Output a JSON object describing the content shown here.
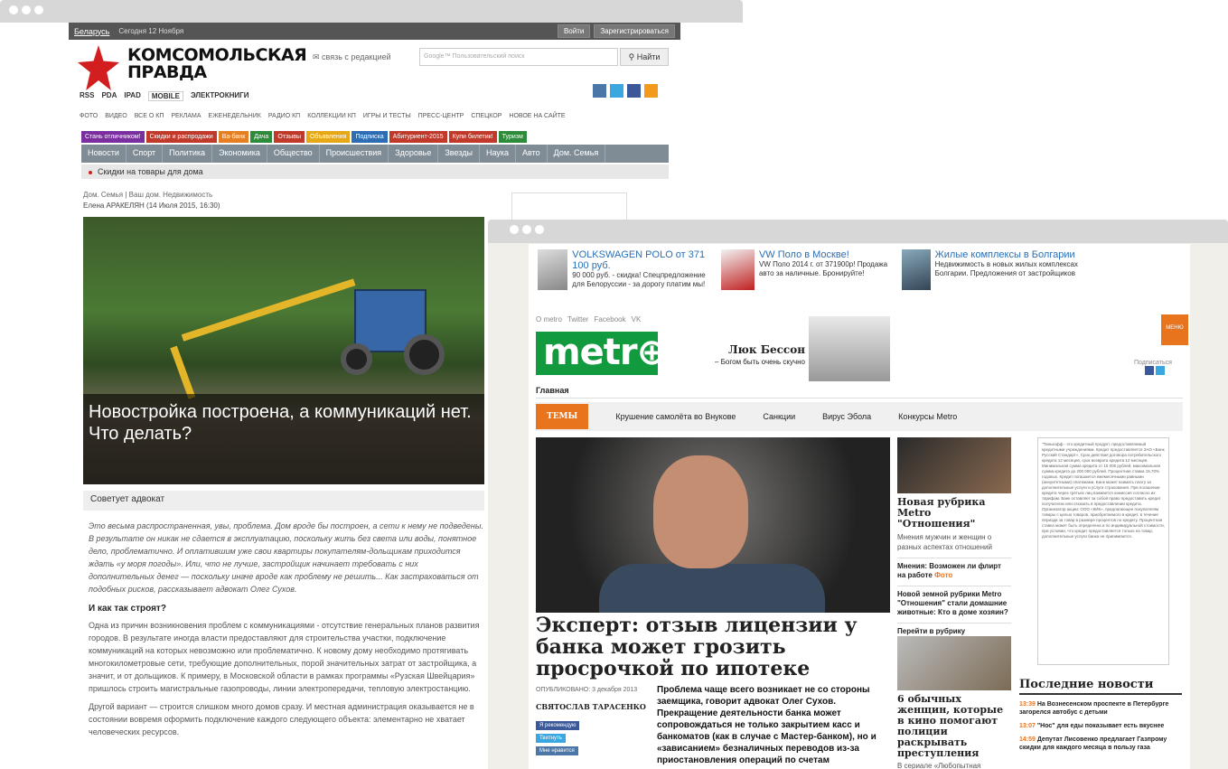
{
  "kp": {
    "region": "Беларусь",
    "today": "Сегодня 12 Ноября",
    "login": "Войти",
    "register": "Зарегистрироваться",
    "logo_line1": "КОМСОМОЛЬСКАЯ",
    "logo_line2": "ПРАВДА",
    "contact": "связь с редакцией",
    "search_placeholder": "Google™ Пользовательский поиск",
    "search_btn": "Найти",
    "links1": [
      "RSS",
      "PDA",
      "IPAD",
      "MOBILE",
      "ЭЛЕКТРОКНИГИ"
    ],
    "links2": [
      "ФОТО",
      "ВИДЕО",
      "ВСЕ О КП",
      "РЕКЛАМА",
      "ЕЖЕНЕДЕЛЬНИК",
      "РАДИО КП",
      "КОЛЛЕКЦИИ КП",
      "ИГРЫ И ТЕСТЫ",
      "ПРЕСС-ЦЕНТР",
      "СПЕЦКОР",
      "НОВОЕ НА САЙТЕ"
    ],
    "pills": [
      {
        "t": "Стань отличником!",
        "c": "#7a2ea0"
      },
      {
        "t": "Скидки и распродажи",
        "c": "#c0392b"
      },
      {
        "t": "Ва-банк",
        "c": "#e67e22"
      },
      {
        "t": "Дача",
        "c": "#2e8b3a"
      },
      {
        "t": "Отзывы",
        "c": "#c0392b"
      },
      {
        "t": "Объявления",
        "c": "#e6a817"
      },
      {
        "t": "Подписка",
        "c": "#2c6db3"
      },
      {
        "t": "Абитуриент-2015",
        "c": "#c0392b"
      },
      {
        "t": "Купи билетик!",
        "c": "#c0392b"
      },
      {
        "t": "Туризм",
        "c": "#2e8b3a"
      }
    ],
    "nav": [
      "Новости",
      "Спорт",
      "Политика",
      "Экономика",
      "Общество",
      "Происшествия",
      "Здоровье",
      "Звезды",
      "Наука",
      "Авто",
      "Дом. Семья"
    ],
    "promo": "Скидки на товары для дома",
    "rubric": "Дом. Семья | Ваш дом. Недвижимость",
    "author": "Елена АРАКЕЛЯН  (14 Июля 2015, 16:30)",
    "photo_caption": "Новостройка построена, а коммуникаций нет. Что делать?",
    "advice": "Советует адвокат",
    "intro": "Это весьма распространенная, увы, проблема. Дом вроде бы построен, а сети к нему не подведены. В результате он никак не сдается в эксплуатацию, поскольку жить без света или воды, понятное дело, проблематично. И оплатившим уже свои квартиры покупателям-дольщикам приходится ждать «у моря погоды». Или, что не лучше, застройщик начинает требовать с них дополнительных денег — поскольку иначе вроде как проблему не решить... Как застраховаться от подобных рисков, рассказывает адвокат Олег Сухов.",
    "subhead": "И как так строят?",
    "p1": "Одна из причин возникновения проблем с коммуникациями - отсутствие генеральных планов развития городов. В результате иногда власти предоставляют для строительства участки, подключение коммуникаций на которых невозможно или проблематично. К новому дому необходимо протягивать многокилометровые сети, требующие дополнительных, порой значительных затрат от застройщика, а значит, и от дольщиков. К примеру, в Московской области в рамках программы «Рузская Швейцария» пришлось строить магистральные газопроводы, линии электропередачи, тепловую электростанцию.",
    "p2": "Другой вариант — строится слишком много домов сразу. И местная администрация оказывается не в состоянии вовремя оформить подключение каждого следующего объекта: элементарно не хватает человеческих ресурсов."
  },
  "metro": {
    "ads": [
      {
        "title": "VOLKSWAGEN POLO от 371 100 руб.",
        "desc": "90 000 руб. - скидка! Спецпредложение для Белоруссии - за дорогу платим мы!"
      },
      {
        "title": "VW Поло в Москве!",
        "desc": "VW Поло 2014 г. от 371900р! Продажа авто за наличные. Бронируйте!"
      },
      {
        "title": "Жилые комплексы в Болгарии",
        "desc": "Недвижимость в новых жилых комплексах Болгарии. Предложения от застройщиков"
      }
    ],
    "toplinks": [
      "О metro",
      "Twitter",
      "Facebook",
      "VK"
    ],
    "logo": "metr",
    "besson_name": "Люк Бессон",
    "besson_quote": "– Богом быть очень скучно",
    "menu": "МЕНЮ",
    "subscribe": "Подписаться",
    "home": "Главная",
    "topics_label": "ТЕМЫ",
    "topics": [
      "Крушение самолёта во Внукове",
      "Санкции",
      "Вирус Эбола",
      "Конкурсы Metro"
    ],
    "headline": "Эксперт: отзыв лицензии у банка может грозить просрочкой по ипотеке",
    "published": "ОПУБЛИКОВАНО: 3 декабря 2013",
    "author": "СВЯТОСЛАВ ТАРАСЕНКО",
    "share": [
      "Я рекомендую",
      "Твитнуть",
      "Мне нравится"
    ],
    "lead": "Проблема чаще всего возникает не со стороны заемщика, говорит адвокат Олег Сухов. Прекращение деятельности банка может сопровождаться не только закрытием касс и банкоматов (как в случае с Мастер-банком), но и «зависанием» безналичных переводов из-за приостановления операций по счетам",
    "side1_title": "Новая рубрика Metro \"Отношения\"",
    "side1_text": "Мнения мужчин и женщин о разных аспектах отношений",
    "side1_link1": "Мнения: Возможен ли флирт на работе",
    "side1_photo": "Фото",
    "side1_link2": "Новой земной рубрики Metro \"Отношения\" стали домашние животные: Кто в доме хозяин?",
    "side1_more": "Перейти в рубрику",
    "side2_title": "6 обычных женщин, которые в кино помогают полиции раскрывать преступления",
    "side2_text": "В сериале «Любопытная",
    "text_box": "\"Тинькофф - это кредитный продукт, предоставляемый кредитными учреждениями. Кредит предоставляется ЗАО «Банк Русский Стандарт». Срок действия договора потребительского кредита 12 месяцев, срок возврата кредита 12 месяцев. Минимальная сумма кредита от 15 000 рублей, максимальная сумма кредита до 200 000 рублей. Процентная ставка 15,70% годовых. Кредит погашается ежемесячными равными (аннуитетными) платежами. Банк может взимать плату за дополнительные услуги и услуги страхования. При погашении кредита через третьих лиц взимается комиссия согласно их тарифам. Банк оставляет за собой право предоставить кредит получателю или отказать в предоставлении кредита. Организатор акции: ООО «КИК», предлагающее покупателям товары с целью товаров, приобретаемого в кредит, в течение периода за товар в размере процентов по кредиту. Процентная ставка может быть определена и по индивидуальной стоимости, при условии, что кредит предоставляется только на товар, дополнительные услуги банка не принимаются.",
    "news_title": "Последние новости",
    "news": [
      {
        "t": "13:39",
        "x": "На Вознесенском проспекте в Петербурге загорелся автобус с детьми"
      },
      {
        "t": "13:07",
        "x": "\"Нос\" для еды показывает есть вкуснее"
      },
      {
        "t": "14:59",
        "x": "Депутат Лисовенко предлагает Газпрому скидки для каждого месяца в пользу газа"
      }
    ]
  },
  "colors": {
    "kp_red": "#d21e1e",
    "metro_green": "#129a3e",
    "metro_orange": "#e8741e",
    "nav_gray": "#7f8c96"
  }
}
